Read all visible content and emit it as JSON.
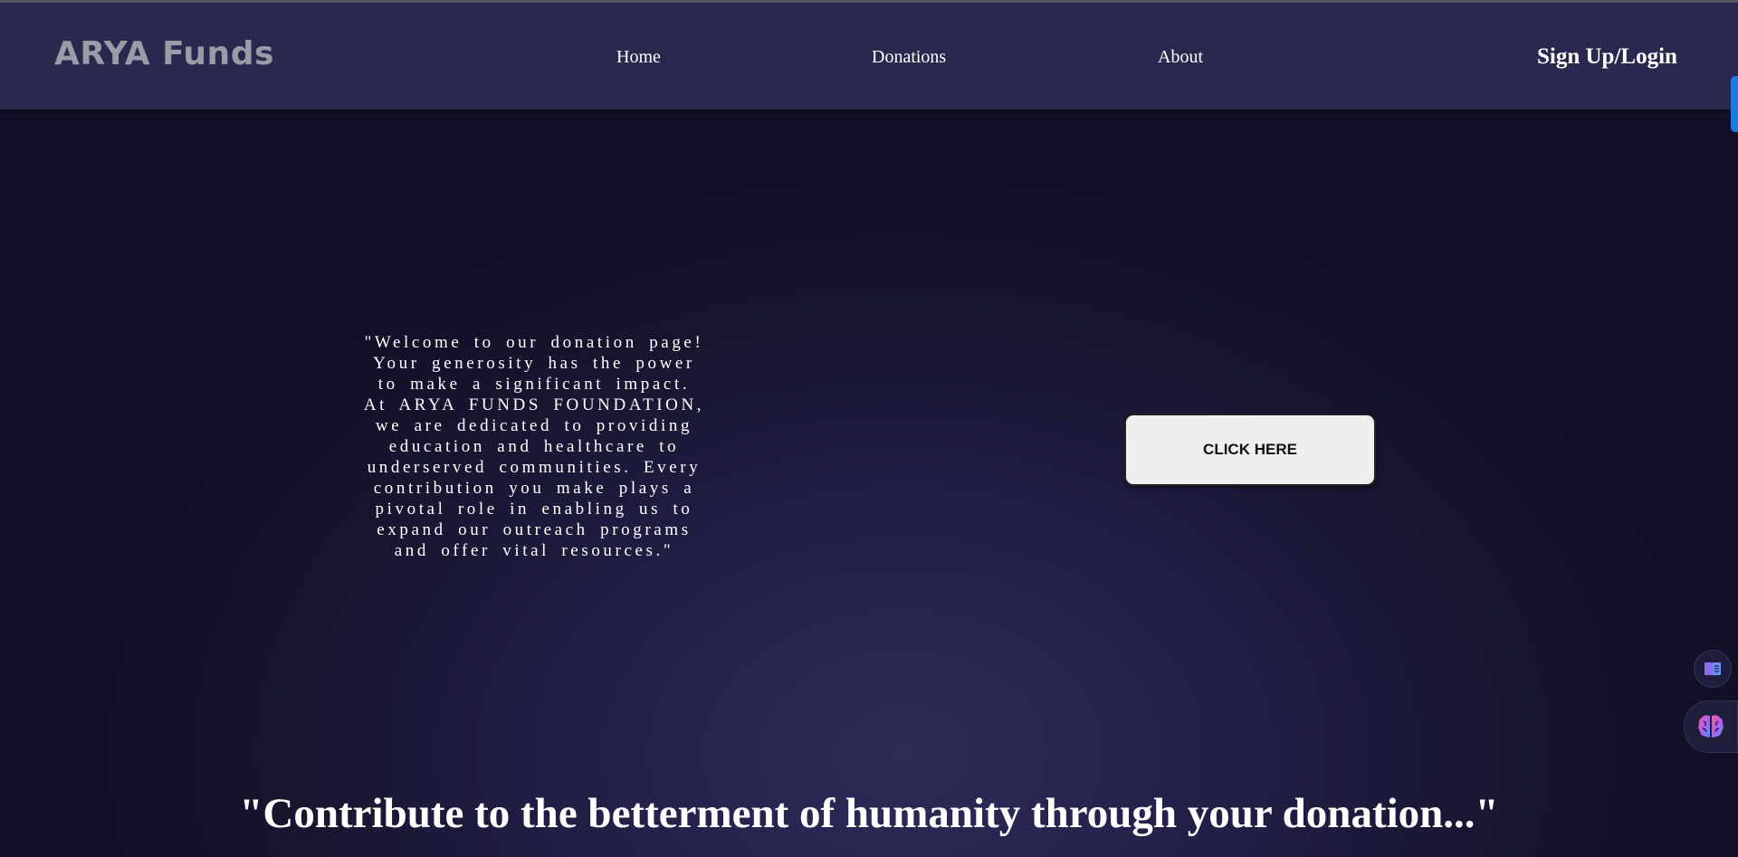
{
  "navbar": {
    "brand": "ARYA Funds",
    "links": [
      {
        "label": "Home"
      },
      {
        "label": "Donations"
      },
      {
        "label": "About"
      }
    ],
    "signup_label": "Sign Up/Login"
  },
  "hero": {
    "welcome_text": "\"Welcome to our donation page! Your generosity has the power to make a significant impact. At ARYA FUNDS FOUNDATION, we are dedicated to providing education and healthcare to underserved communities. Every contribution you make plays a pivotal role in enabling us to expand our outreach programs and offer vital resources.\"",
    "cta_label": "CLICK HERE"
  },
  "tagline": "\"Contribute to the betterment of humanity through your donation...\"",
  "floating_buttons": [
    {
      "icon": "book-icon"
    },
    {
      "icon": "brain-icon"
    }
  ],
  "colors": {
    "navbar_bg": "#2a284d",
    "page_bg": "#17152f",
    "brand_text": "#9a9aa8",
    "accent_tab": "#1e7ae0",
    "button_bg": "#efefef"
  }
}
